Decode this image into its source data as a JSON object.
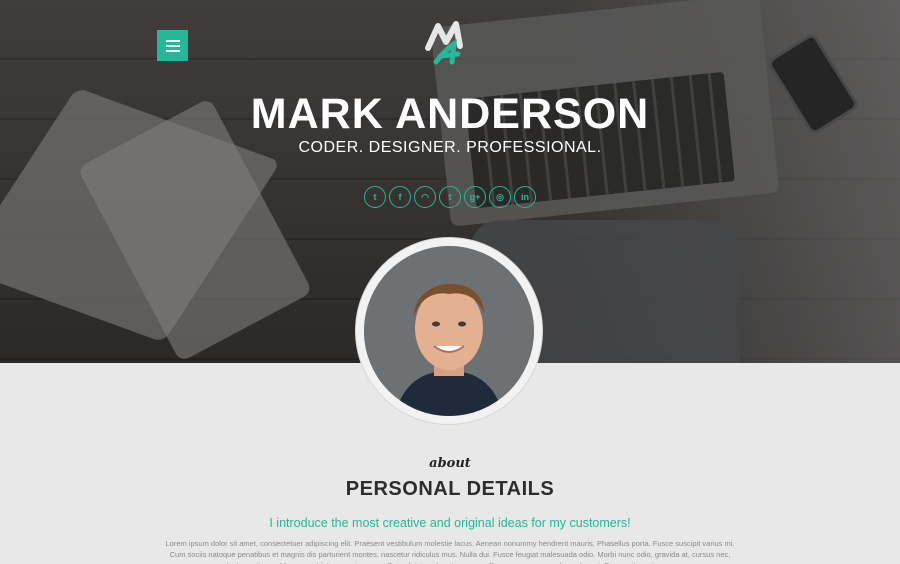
{
  "hero": {
    "name": "MARK ANDERSON",
    "tagline": "CODER. DESIGNER. PROFESSIONAL.",
    "accent_color": "#26b79a"
  },
  "menu": {
    "icon": "hamburger-menu-icon"
  },
  "logo": {
    "icon": "ma-monogram-logo"
  },
  "socials": [
    {
      "icon": "twitter-icon",
      "glyph": "t"
    },
    {
      "icon": "facebook-icon",
      "glyph": "f"
    },
    {
      "icon": "rss-icon",
      "glyph": "◠"
    },
    {
      "icon": "tumblr-icon",
      "glyph": "t"
    },
    {
      "icon": "google-plus-icon",
      "glyph": "g+"
    },
    {
      "icon": "dribbble-icon",
      "glyph": "◎"
    },
    {
      "icon": "linkedin-icon",
      "glyph": "in"
    }
  ],
  "about": {
    "kicker": "about",
    "title": "PERSONAL DETAILS",
    "intro": "I introduce the most creative and original ideas for my customers!",
    "body": "Lorem ipsum dolor sit amet, consectetuer adipiscing elit. Praesent vestibulum molestie lacus. Aenean nonummy hendrerit mauris. Phasellus porta. Fusce suscipit varius mi. Cum sociis natoque penatibus et magnis dis parturient montes, nascetur ridiculus mus. Nulla dui. Fusce feugiat malesuada odio. Morbi nunc odio, gravida at, cursus nec, luctus a, lorem. Maecenas tristique orci ac sem. Duis ultricies pharetra magna. Donec accumsan malesuada orci. Donec sit amet eros."
  }
}
